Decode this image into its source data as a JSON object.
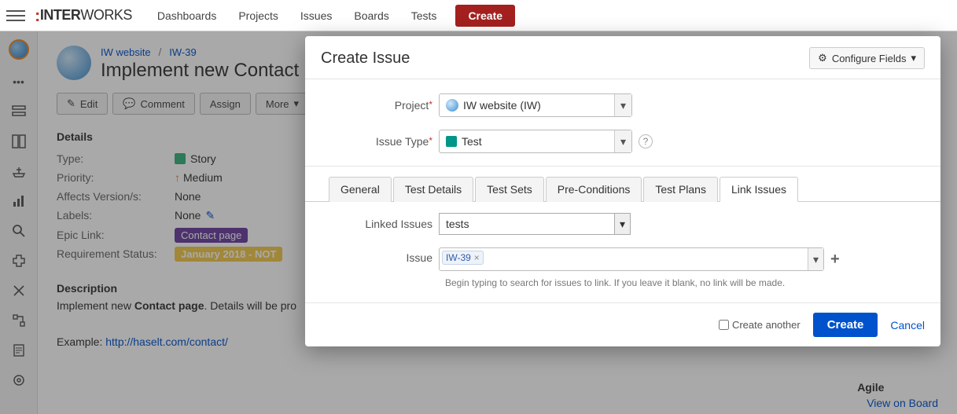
{
  "nav": {
    "items": [
      "Dashboards",
      "Projects",
      "Issues",
      "Boards",
      "Tests"
    ],
    "create": "Create",
    "logo_a": "INTER",
    "logo_b": "WORKS"
  },
  "breadcrumb": {
    "project": "IW website",
    "issue": "IW-39"
  },
  "page": {
    "title": "Implement new Contact"
  },
  "toolbar": {
    "edit": "Edit",
    "comment": "Comment",
    "assign": "Assign",
    "more": "More"
  },
  "details": {
    "heading": "Details",
    "rows": [
      {
        "label": "Type:",
        "value": "Story"
      },
      {
        "label": "Priority:",
        "value": "Medium"
      },
      {
        "label": "Affects Version/s:",
        "value": "None"
      },
      {
        "label": "Labels:",
        "value": "None"
      },
      {
        "label": "Epic Link:",
        "value": "Contact page"
      },
      {
        "label": "Requirement Status:",
        "value": "January 2018 - NOT"
      }
    ]
  },
  "description": {
    "heading": "Description",
    "pre": "Implement new ",
    "bold": "Contact page",
    "post": ". Details will be pro",
    "example_label": "Example: ",
    "example_url": "http://haselt.com/contact/"
  },
  "agile": {
    "heading": "Agile",
    "link": "View on Board"
  },
  "modal": {
    "title": "Create Issue",
    "configure": "Configure Fields",
    "fields": {
      "project_label": "Project",
      "project_value": "IW website (IW)",
      "issuetype_label": "Issue Type",
      "issuetype_value": "Test"
    },
    "tabs": [
      "General",
      "Test Details",
      "Test Sets",
      "Pre-Conditions",
      "Test Plans",
      "Link Issues"
    ],
    "active_tab": 5,
    "linked_issues_label": "Linked Issues",
    "linked_issues_value": "tests",
    "issue_label": "Issue",
    "issue_token": "IW-39",
    "issue_hint": "Begin typing to search for issues to link. If you leave it blank, no link will be made.",
    "create_another": "Create another",
    "submit": "Create",
    "cancel": "Cancel"
  }
}
